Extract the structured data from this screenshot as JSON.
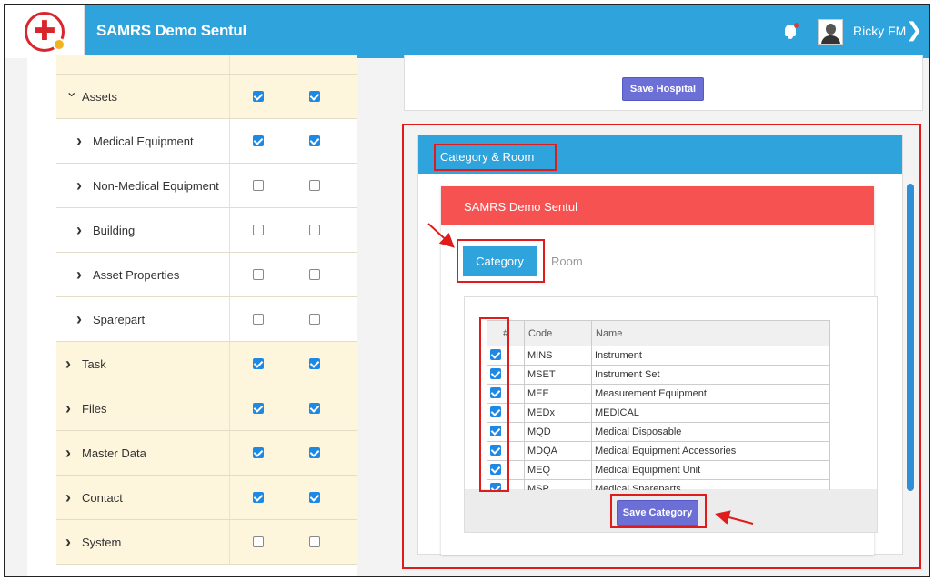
{
  "header": {
    "app_title": "SAMRS Demo Sentul",
    "user_name": "Ricky FM",
    "brand_color": "#2ea3dc"
  },
  "permissions": {
    "rows": [
      {
        "label": "",
        "level": "strip",
        "a": false,
        "b": false,
        "shown": false
      },
      {
        "label": "Assets",
        "level": "top",
        "expanded": true,
        "a": true,
        "b": true
      },
      {
        "label": "Medical Equipment",
        "level": "sub",
        "a": true,
        "b": true
      },
      {
        "label": "Non-Medical Equipment",
        "level": "sub",
        "a": false,
        "b": false
      },
      {
        "label": "Building",
        "level": "sub",
        "a": false,
        "b": false
      },
      {
        "label": "Asset Properties",
        "level": "sub",
        "a": false,
        "b": false
      },
      {
        "label": "Sparepart",
        "level": "sub",
        "a": false,
        "b": false
      },
      {
        "label": "Task",
        "level": "top",
        "a": true,
        "b": true
      },
      {
        "label": "Files",
        "level": "top",
        "a": true,
        "b": true
      },
      {
        "label": "Master Data",
        "level": "top",
        "a": true,
        "b": true
      },
      {
        "label": "Contact",
        "level": "top",
        "a": true,
        "b": true
      },
      {
        "label": "System",
        "level": "top",
        "a": false,
        "b": false
      }
    ]
  },
  "hospital": {
    "save_label": "Save Hospital"
  },
  "category_room": {
    "title": "Category & Room",
    "hospital_name": "SAMRS Demo Sentul",
    "tabs": {
      "category": "Category",
      "room": "Room"
    },
    "table": {
      "headers": {
        "hash": "#",
        "code": "Code",
        "name": "Name"
      },
      "rows": [
        {
          "checked": true,
          "code": "MINS",
          "name": "Instrument"
        },
        {
          "checked": true,
          "code": "MSET",
          "name": "Instrument Set"
        },
        {
          "checked": true,
          "code": "MEE",
          "name": "Measurement Equipment"
        },
        {
          "checked": true,
          "code": "MEDx",
          "name": "MEDICAL"
        },
        {
          "checked": true,
          "code": "MQD",
          "name": "Medical Disposable"
        },
        {
          "checked": true,
          "code": "MDQA",
          "name": "Medical Equipment Accessories"
        },
        {
          "checked": true,
          "code": "MEQ",
          "name": "Medical Equipment Unit"
        },
        {
          "checked": true,
          "code": "MSP",
          "name": "Medical Spareparts"
        }
      ]
    },
    "save_label": "Save Category"
  },
  "annotation_color": "#e01b1b"
}
